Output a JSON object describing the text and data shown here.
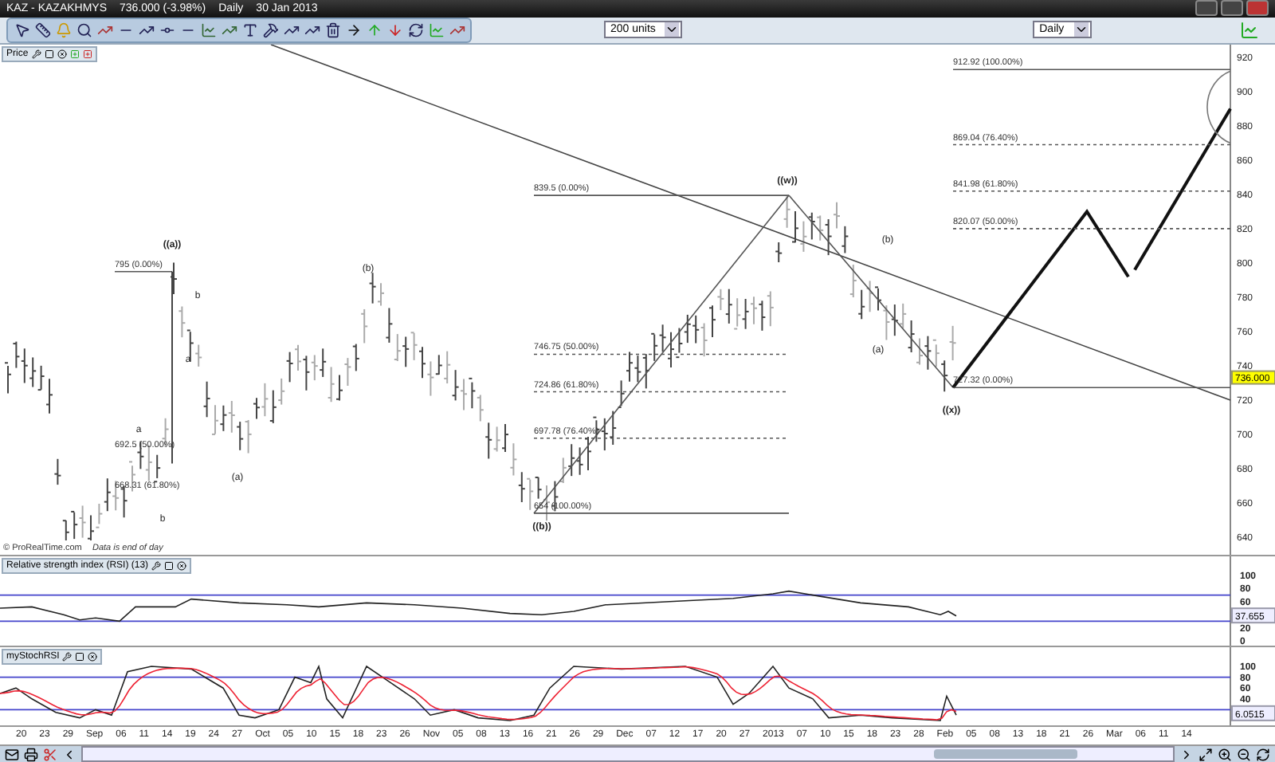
{
  "title_bar": {
    "symbol": "KAZ - KAZAKHMYS",
    "quote": "736.000 (-3.98%)",
    "period": "Daily",
    "date": "30 Jan 2013"
  },
  "toolbar": {
    "units_select": "200 units",
    "period_select": "Daily"
  },
  "price_panel": {
    "title": "Price",
    "y_ticks": [
      "920",
      "900",
      "880",
      "860",
      "840",
      "820",
      "800",
      "780",
      "760",
      "740",
      "720",
      "700",
      "680",
      "660",
      "640"
    ],
    "price_tag": "736.000",
    "fib_labels": [
      "795 (0.00%)",
      "692.5 (50.00%)",
      "668.31 (61.80%)",
      "839.5 (0.00%)",
      "746.75 (50.00%)",
      "724.86 (61.80%)",
      "697.78 (76.40%)",
      "654 (100.00%)",
      "912.92 (100.00%)",
      "869.04 (76.40%)",
      "841.98 (61.80%)",
      "820.07 (50.00%)",
      "727.32 (0.00%)"
    ],
    "wave_labels": [
      "((a))",
      "b",
      "a",
      "a",
      "b",
      "(a)",
      "(b)",
      "((b))",
      "((w))",
      "(b)",
      "(a)",
      "((x))"
    ],
    "copyright": "© ProRealTime.com",
    "notice": "Data is end of day"
  },
  "rsi_panel": {
    "title": "Relative strength index (RSI) (13)",
    "y_ticks": [
      "100",
      "80",
      "60",
      "20",
      "0"
    ],
    "value_tag": "37.655"
  },
  "stoch_panel": {
    "title": "myStochRSI",
    "y_ticks": [
      "100",
      "80",
      "60",
      "40"
    ],
    "value_tag": "6.0515"
  },
  "x_axis": {
    "labels": [
      "20",
      "23",
      "29",
      "Sep",
      "06",
      "11",
      "14",
      "19",
      "24",
      "27",
      "Oct",
      "05",
      "10",
      "15",
      "18",
      "23",
      "26",
      "Nov",
      "05",
      "08",
      "13",
      "16",
      "21",
      "26",
      "29",
      "Dec",
      "07",
      "12",
      "17",
      "20",
      "27",
      "2013",
      "07",
      "10",
      "15",
      "18",
      "23",
      "28",
      "Feb",
      "05",
      "08",
      "13",
      "18",
      "21",
      "26",
      "Mar",
      "06",
      "11",
      "14"
    ]
  }
}
